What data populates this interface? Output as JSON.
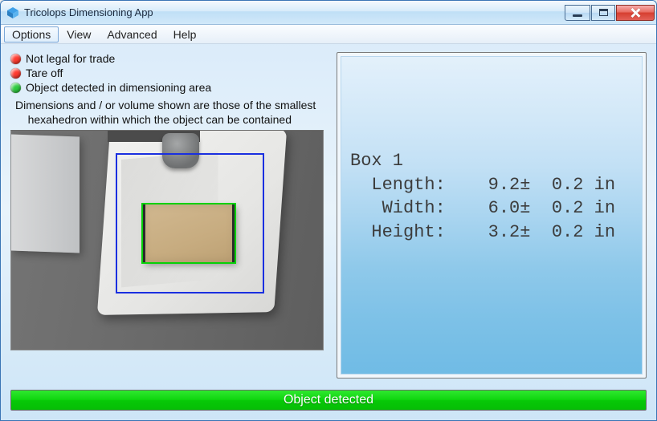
{
  "window": {
    "title": "Tricolops Dimensioning App"
  },
  "menu": {
    "items": [
      "Options",
      "View",
      "Advanced",
      "Help"
    ],
    "selected_index": 0
  },
  "status": {
    "items": [
      {
        "color": "#ff3b30",
        "text": "Not legal for trade"
      },
      {
        "color": "#ff3b30",
        "text": "Tare off"
      },
      {
        "color": "#2ecc40",
        "text": "Object detected in dimensioning area"
      }
    ],
    "hint_line1": "Dimensions and / or volume shown are those of the smallest",
    "hint_line2": "hexahedron within which the object can be contained"
  },
  "results": {
    "title": "Box 1",
    "rows": [
      {
        "label": "Length:",
        "value": "9.2",
        "tol": "0.2",
        "unit": "in"
      },
      {
        "label": "Width:",
        "value": "6.0",
        "tol": "0.2",
        "unit": "in"
      },
      {
        "label": "Height:",
        "value": "3.2",
        "tol": "0.2",
        "unit": "in"
      }
    ]
  },
  "footer": {
    "text": "Object detected"
  }
}
